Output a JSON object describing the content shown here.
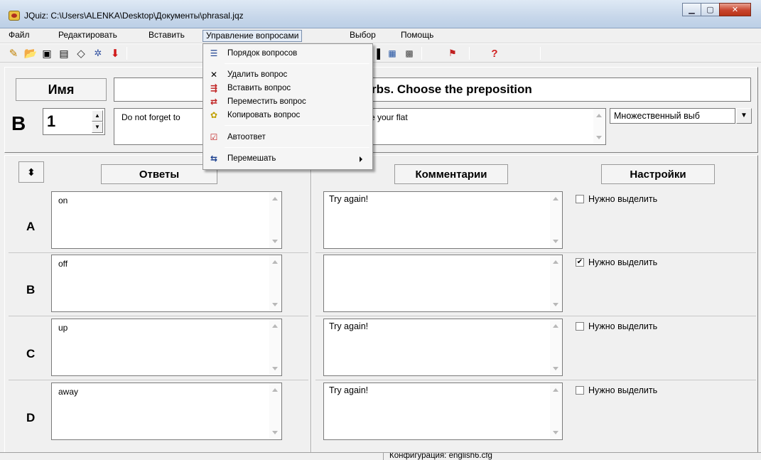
{
  "window": {
    "title": "JQuiz: C:\\Users\\ALENKA\\Desktop\\Документы\\phrasal.jqz",
    "minimize_icon": "minimize-icon",
    "maximize_icon": "maximize-icon",
    "close_icon": "close-icon"
  },
  "menubar": {
    "items": [
      "Файл",
      "Редактировать",
      "Вставить",
      "Управление вопросами",
      "Выбор",
      "Помощь"
    ]
  },
  "dropdown": {
    "items": [
      {
        "label": "Порядок вопросов",
        "icon": "list-order-icon"
      },
      {
        "label": "Удалить вопрос",
        "icon": "delete-x-icon"
      },
      {
        "label": "Вставить вопрос",
        "icon": "insert-question-icon"
      },
      {
        "label": "Переместить вопрос",
        "icon": "move-question-icon"
      },
      {
        "label": "Копировать вопрос",
        "icon": "copy-question-icon"
      },
      {
        "label": "Автоответ",
        "icon": "auto-answer-icon"
      },
      {
        "label": "Перемешать",
        "icon": "shuffle-icon"
      }
    ]
  },
  "header": {
    "name_label": "Имя",
    "title_visible": "rbs. Choose the preposition",
    "question_label": "В",
    "question_number": "1",
    "question_text_left": "Do not forget to",
    "question_text_right": "e your flat",
    "question_type": "Множественный выб"
  },
  "columns": {
    "answers": "Ответы",
    "comments": "Комментарии",
    "settings": "Настройки"
  },
  "rows": [
    {
      "letter": "A",
      "answer": "on",
      "comment": "Try again!",
      "check_label": "Нужно выделить",
      "checked": false
    },
    {
      "letter": "B",
      "answer": "off",
      "comment": "",
      "check_label": "Нужно выделить",
      "checked": true
    },
    {
      "letter": "C",
      "answer": "up",
      "comment": "Try again!",
      "check_label": "Нужно выделить",
      "checked": false
    },
    {
      "letter": "D",
      "answer": "away",
      "comment": "Try again!",
      "check_label": "Нужно выделить",
      "checked": false
    }
  ],
  "status": {
    "config": "Конфигурация: english6.cfg"
  }
}
